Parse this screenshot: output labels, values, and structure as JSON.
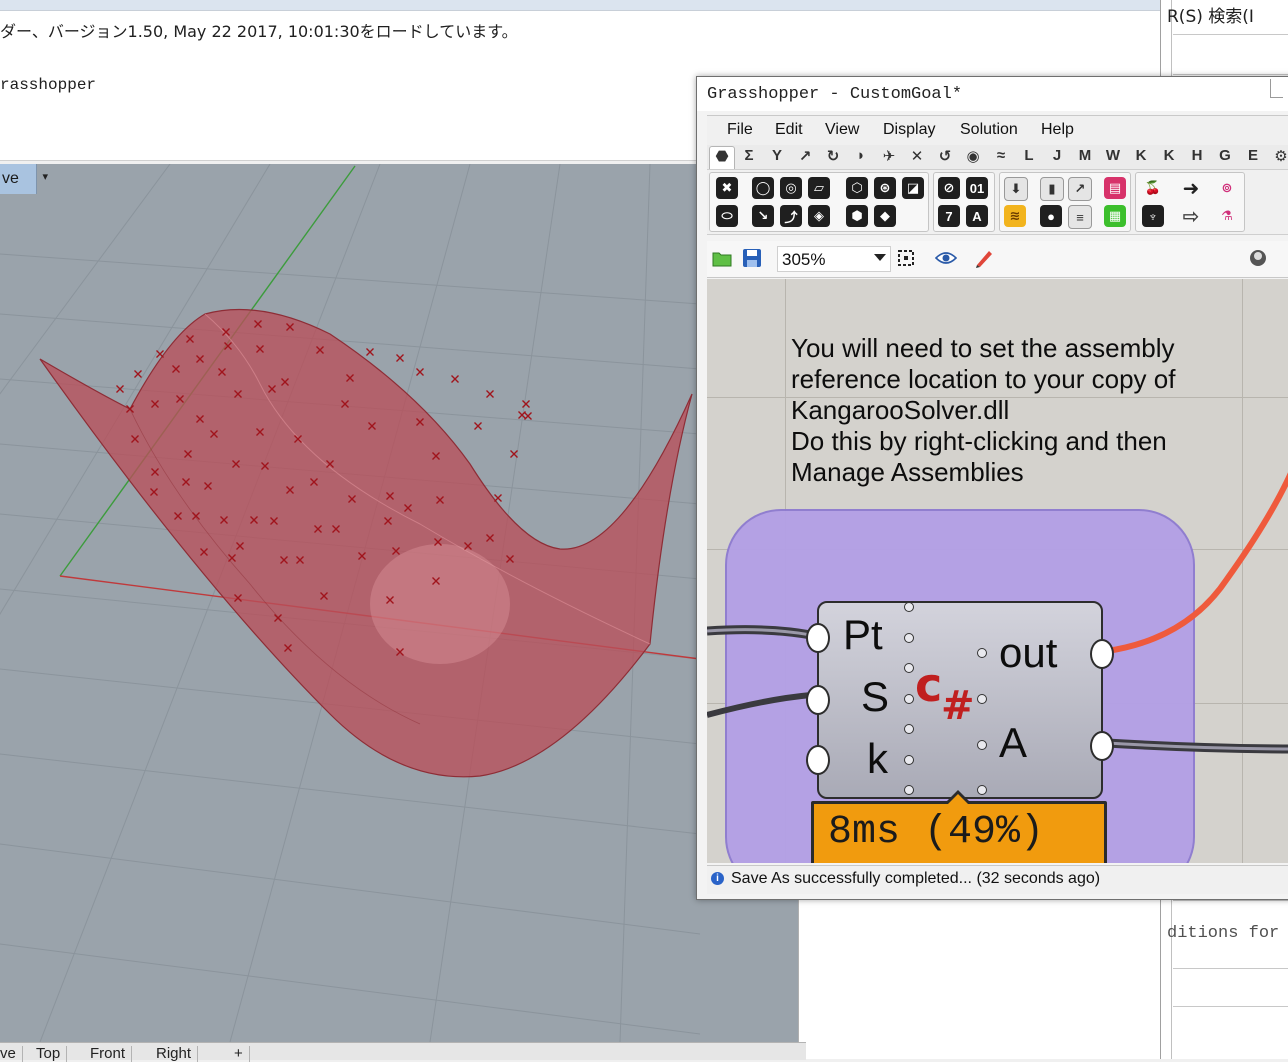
{
  "rhino": {
    "history_line1": "ダー、バージョン1.50, May 22 2017, 10:01:30をロードしています。",
    "history_line2": "rasshopper",
    "viewport_label": "ve",
    "viewport_tabs": [
      "ve",
      "Top",
      "Front",
      "Right",
      "+"
    ],
    "right_panel_search": "R(S)  検索(I",
    "right_panel_conditions": "ditions for"
  },
  "gh": {
    "window_title": "Grasshopper - CustomGoal*",
    "menus": [
      "File",
      "Edit",
      "View",
      "Display",
      "Solution",
      "Help"
    ],
    "tabs": [
      "⬣",
      "Σ",
      "Y",
      "↗",
      "↻",
      "◗",
      "✈",
      "✕",
      "↺",
      "◉",
      "≈",
      "L",
      "J",
      "M",
      "W",
      "K",
      "K",
      "H",
      "G",
      "E",
      "⚙"
    ],
    "zoom": "305%",
    "note": "You will need to set the assembly\nreference location to your copy of\nKangarooSolver.dll\nDo this by right-clicking and then\nManage Assemblies",
    "component": {
      "inputs": [
        "Pt",
        "S",
        "k"
      ],
      "outputs": [
        "out",
        "A"
      ],
      "icon": "csharp-script-icon"
    },
    "timing": "8ms (49%)",
    "status": "Save As successfully completed... (32 seconds ago)",
    "colors": {
      "group_fill": "#b39fe6",
      "timing_bg": "#f19b0e",
      "wire_out": "#ef5a3c",
      "surface": "#b8505a",
      "canvas_bg": "#d4d2cd"
    }
  }
}
